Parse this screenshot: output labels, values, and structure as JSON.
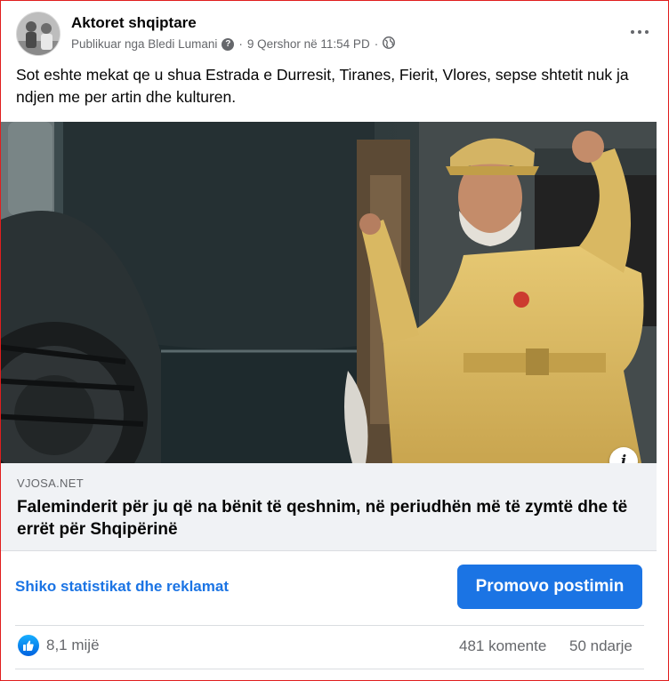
{
  "post": {
    "page_name": "Aktoret shqiptare",
    "published_by": "Publikuar nga Bledi Lumani",
    "timestamp": "9 Qershor në 11:54 PD",
    "separator": "·",
    "text": "Sot eshte mekat qe u shua Estrada e Durresit, Tiranes, Fierit, Vlores, sepse shtetit nuk ja ndjen me per artin dhe kulturen."
  },
  "link_card": {
    "domain": "VJOSA.NET",
    "title": "Faleminderit për ju që na bënit të qeshnim, në periudhën më të zymtë dhe të errët për Shqipërinë",
    "info_icon": "i"
  },
  "actions": {
    "stats_link": "Shiko statistikat dhe reklamat",
    "promote_button": "Promovo postimin"
  },
  "engagement": {
    "reactions": "8,1 mijë",
    "comments": "481 komente",
    "shares": "50 ndarje"
  },
  "icons": {
    "more": "more-options-icon",
    "privacy": "globe-icon",
    "help": "question-icon",
    "like": "like-icon"
  },
  "colors": {
    "accent": "#1b74e4",
    "secondary_text": "#65676b",
    "card_bg": "#f0f2f5",
    "frame_border": "#e01e1e"
  }
}
